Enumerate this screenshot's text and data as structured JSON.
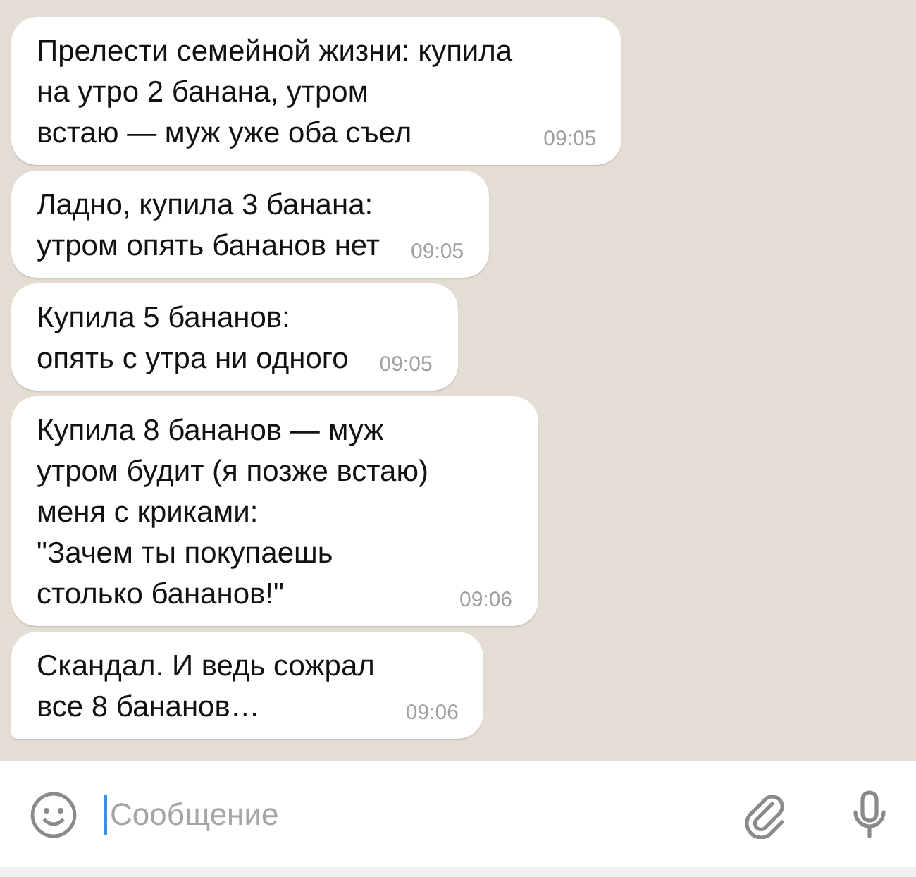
{
  "messages": [
    {
      "text": "Прелести семейной жизни: купила\nна утро 2 банана, утром\nвстаю — муж уже оба съел",
      "time": "09:05"
    },
    {
      "text": "Ладно, купила 3 банана:\nутром опять бананов нет",
      "time": "09:05"
    },
    {
      "text": "Купила 5 бананов:\nопять с утра ни одного",
      "time": "09:05"
    },
    {
      "text": "Купила 8 бананов — муж\nутром будит (я позже встаю)\nменя с криками:\n\"Зачем ты покупаешь\nстолько бананов!\"",
      "time": "09:06"
    },
    {
      "text": "Скандал. И ведь сожрал\nвсе 8 бананов…",
      "time": "09:06"
    }
  ],
  "composer": {
    "placeholder": "Сообщение"
  }
}
